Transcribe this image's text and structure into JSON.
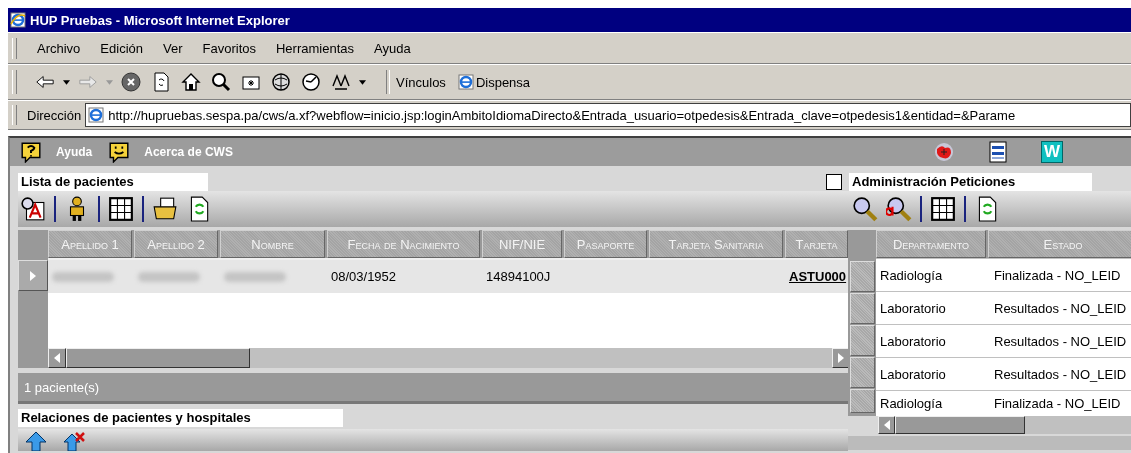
{
  "window": {
    "title": "HUP Pruebas - Microsoft Internet Explorer"
  },
  "menu": [
    "Archivo",
    "Edición",
    "Ver",
    "Favoritos",
    "Herramientas",
    "Ayuda"
  ],
  "toolbar": {
    "links_label": "Vínculos",
    "links": [
      "Dispensa"
    ]
  },
  "address_bar": {
    "label": "Dirección",
    "value": "http://hupruebas.sespa.pa/cws/a.xf?webflow=inicio.jsp:loginAmbitoIdiomaDirecto&Entrada_usuario=otpedesis&Entrada_clave=otpedesis1&entidad=&Parame"
  },
  "app_header": {
    "items": [
      {
        "kind": "help",
        "label": "Ayuda"
      },
      {
        "kind": "about",
        "label": "Acerca de CWS"
      }
    ],
    "tools": [
      {
        "kind": "splat"
      },
      {
        "kind": "sheet"
      },
      {
        "kind": "letter",
        "text": "W"
      }
    ]
  },
  "patients": {
    "title": "Lista de pacientes",
    "columns": [
      "Apellido 1",
      "Apellido 2",
      "Nombre",
      "Fecha de Nacimiento",
      "NIF/NIE",
      "Pasaporte",
      "Tarjeta Sanitaria",
      "Tarjeta"
    ],
    "rows": [
      {
        "selected": true,
        "cells": [
          {
            "kind": "redacted"
          },
          {
            "kind": "redacted"
          },
          {
            "kind": "redacted"
          },
          {
            "kind": "text",
            "text": "08/03/1952"
          },
          {
            "kind": "text",
            "text": "14894100J"
          },
          {
            "kind": "empty"
          },
          {
            "kind": "empty"
          },
          {
            "kind": "link",
            "text": "ASTU000"
          }
        ]
      }
    ],
    "status": "1 paciente(s)"
  },
  "relations": {
    "title": "Relaciones de pacientes y hospitales"
  },
  "requests": {
    "title": "Administración Peticiones",
    "checked": false,
    "columns": [
      "Departamento",
      "Estado"
    ],
    "rows": [
      {
        "department": "Radiología",
        "status": "Finalizada - NO_LEID"
      },
      {
        "department": "Laboratorio",
        "status": "Resultados - NO_LEID"
      },
      {
        "department": "Laboratorio",
        "status": "Resultados - NO_LEID"
      },
      {
        "department": "Laboratorio",
        "status": "Resultados - NO_LEID"
      },
      {
        "department": "Radiología",
        "status": "Finalizada - NO_LEID"
      }
    ]
  }
}
